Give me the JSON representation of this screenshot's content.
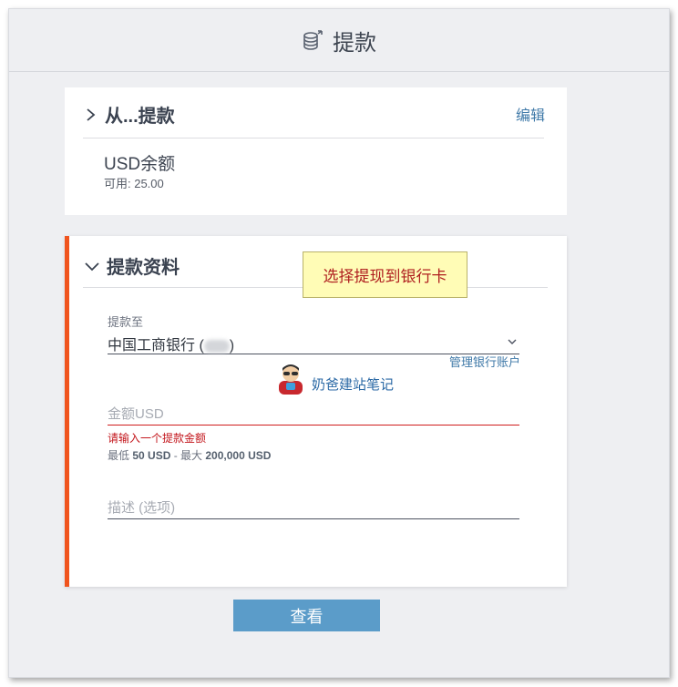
{
  "header": {
    "title": "提款",
    "icon": "coin-stack-icon"
  },
  "from_section": {
    "title": "从...提款",
    "edit_label": "编辑",
    "balance_title": "USD余额",
    "available_label": "可用: 25.00"
  },
  "details_section": {
    "title": "提款资料",
    "to_label": "提款至",
    "bank_value": "中国工商银行 (",
    "bank_value_suffix": ")",
    "manage_label": "管理银行账户",
    "amount_placeholder": "金额USD",
    "error_text": "请输入一个提款金额",
    "limit_min_prefix": "最低 ",
    "limit_min": "50 USD",
    "limit_sep": " - 最大 ",
    "limit_max": "200,000 USD",
    "description_placeholder": "描述 (选项)"
  },
  "tooltip": {
    "text": "选择提现到银行卡"
  },
  "watermark": {
    "text": "奶爸建站笔记"
  },
  "review_button": {
    "label": "查看"
  },
  "colors": {
    "accent": "#f0541e",
    "link": "#3f79a8",
    "error": "#c3161c",
    "button": "#5b9cc9",
    "tooltip_bg": "#fffcb6"
  }
}
